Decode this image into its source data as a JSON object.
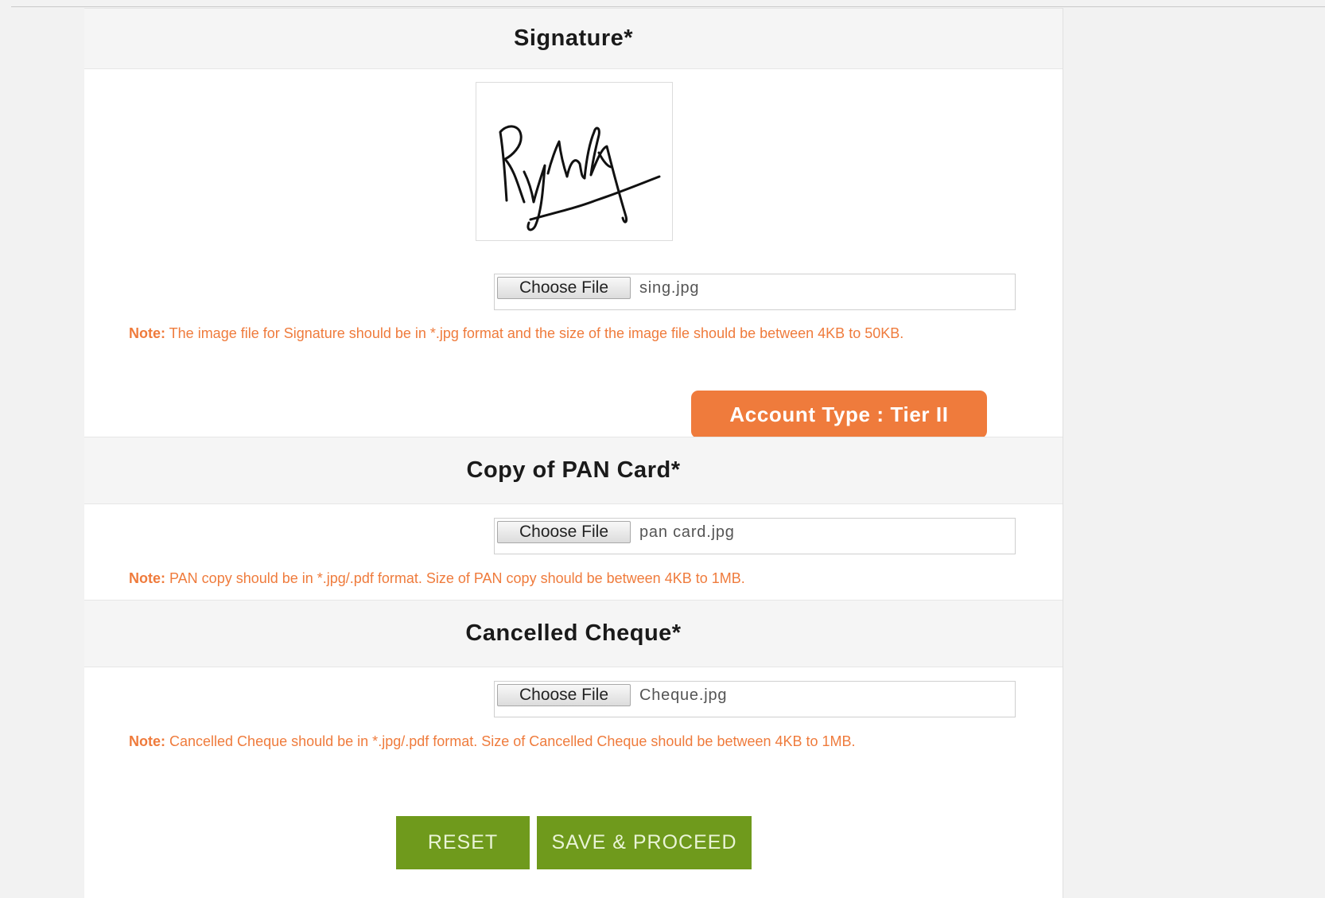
{
  "sections": {
    "signature": {
      "title": "Signature*",
      "choose_label": "Choose File",
      "file_name": "sing.jpg",
      "note_label": "Note:",
      "note_text": " The image file for Signature should be in *.jpg format and the size of the image file should be between 4KB to 50KB."
    },
    "pan": {
      "title": "Copy of PAN Card*",
      "choose_label": "Choose File",
      "file_name": "pan card.jpg",
      "note_label": "Note:",
      "note_text": " PAN copy should be in *.jpg/.pdf format. Size of PAN copy should be between 4KB to 1MB."
    },
    "cheque": {
      "title": "Cancelled Cheque*",
      "choose_label": "Choose File",
      "file_name": "Cheque.jpg",
      "note_label": "Note:",
      "note_text": " Cancelled Cheque should be in *.jpg/.pdf format. Size of Cancelled Cheque should be between 4KB to 1MB."
    }
  },
  "account_type_badge": "Account Type : Tier II",
  "buttons": {
    "reset": "RESET",
    "save": "SAVE & PROCEED"
  },
  "colors": {
    "note_orange": "#ef7b3c",
    "button_green": "#6f9a1c"
  },
  "icons": {
    "signature_preview": "signature-image"
  }
}
